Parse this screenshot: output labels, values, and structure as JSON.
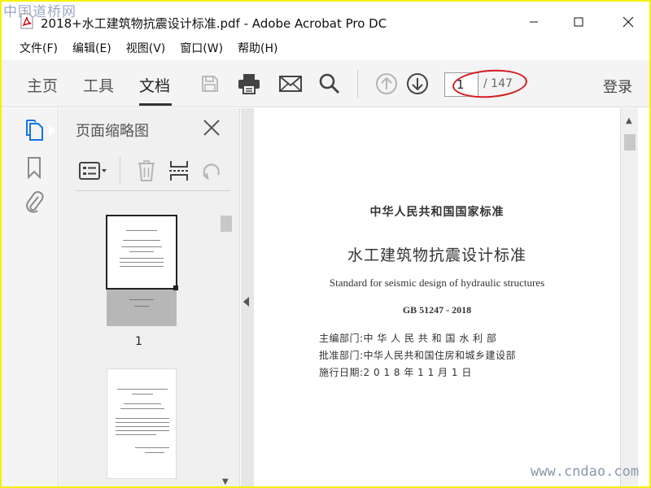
{
  "watermark": "中国道桥网",
  "window": {
    "title": "2018+水工建筑物抗震设计标准.pdf - Adobe Acrobat Pro DC",
    "icons": [
      "minimize-icon",
      "maximize-icon",
      "close-icon"
    ]
  },
  "menu": [
    "文件(F)",
    "编辑(E)",
    "视图(V)",
    "窗口(W)",
    "帮助(H)"
  ],
  "toolbar": {
    "tabs": [
      "主页",
      "工具",
      "文档"
    ],
    "active_tab": "文档",
    "icons": [
      "save-icon",
      "print-icon",
      "email-icon",
      "search-icon",
      "page-up-icon",
      "page-down-icon"
    ],
    "page_current": "1",
    "page_total": "/ 147",
    "signin": "登录",
    "annotation_color": "#d41c1c"
  },
  "left_rail": {
    "icons": [
      "page-thumbnails-icon",
      "bookmark-icon",
      "attachment-icon"
    ],
    "accent": "#1473e6"
  },
  "thumb_panel": {
    "title": "页面缩略图",
    "toolbar_icons": [
      "thumbnail-options-icon",
      "delete-page-icon",
      "extract-pages-icon",
      "rotate-icon"
    ],
    "thumbnails": [
      {
        "label": "1"
      },
      {
        "label": ""
      }
    ]
  },
  "document": {
    "authority": "中华人民共和国国家标准",
    "title_cn": "水工建筑物抗震设计标准",
    "title_en": "Standard for seismic design of hydraulic structures",
    "code": "GB 51247 - 2018",
    "meta": [
      "主编部门:中 华 人 民 共 和 国 水 利 部",
      "批准部门:中华人民共和国住房和城乡建设部",
      "施行日期:2 0 1 8 年 1 1 月 1 日"
    ]
  },
  "site_watermark": "www.cndao.com"
}
